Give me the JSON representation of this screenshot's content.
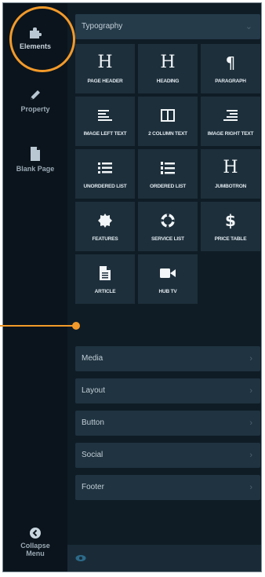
{
  "sidebar": {
    "items": [
      {
        "label": "Elements",
        "icon": "puzzle-icon",
        "active": true
      },
      {
        "label": "Property",
        "icon": "pencil-icon",
        "active": false
      },
      {
        "label": "Blank Page",
        "icon": "page-icon",
        "active": false
      }
    ],
    "collapse_line1": "Collapse",
    "collapse_line2": "Menu"
  },
  "panel": {
    "header": "Typography",
    "tiles": [
      {
        "label": "PAGE HEADER",
        "icon": "heading-h-icon"
      },
      {
        "label": "HEADING",
        "icon": "heading-h-icon"
      },
      {
        "label": "PARAGRAPH",
        "icon": "paragraph-icon"
      },
      {
        "label": "IMAGE LEFT TEXT",
        "icon": "align-left-icon"
      },
      {
        "label": "2 COLUMN TEXT",
        "icon": "columns-icon"
      },
      {
        "label": "IMAGE RIGHT TEXT",
        "icon": "align-right-icon"
      },
      {
        "label": "UNORDERED LIST",
        "icon": "bullet-list-icon"
      },
      {
        "label": "ORDERED LIST",
        "icon": "ordered-list-icon"
      },
      {
        "label": "JUMBOTRON",
        "icon": "heading-h-icon"
      },
      {
        "label": "FEATURES",
        "icon": "badge-icon"
      },
      {
        "label": "SERVICE LIST",
        "icon": "lifebuoy-icon"
      },
      {
        "label": "PRICE TABLE",
        "icon": "dollar-icon"
      },
      {
        "label": "ARTICLE",
        "icon": "document-icon"
      },
      {
        "label": "HUB TV",
        "icon": "video-camera-icon"
      }
    ],
    "sections": [
      "Media",
      "Layout",
      "Button",
      "Social",
      "Footer"
    ]
  },
  "colors": {
    "accent": "#f39a2a",
    "background": "#0f1c26",
    "tile": "#1d2f3b"
  }
}
